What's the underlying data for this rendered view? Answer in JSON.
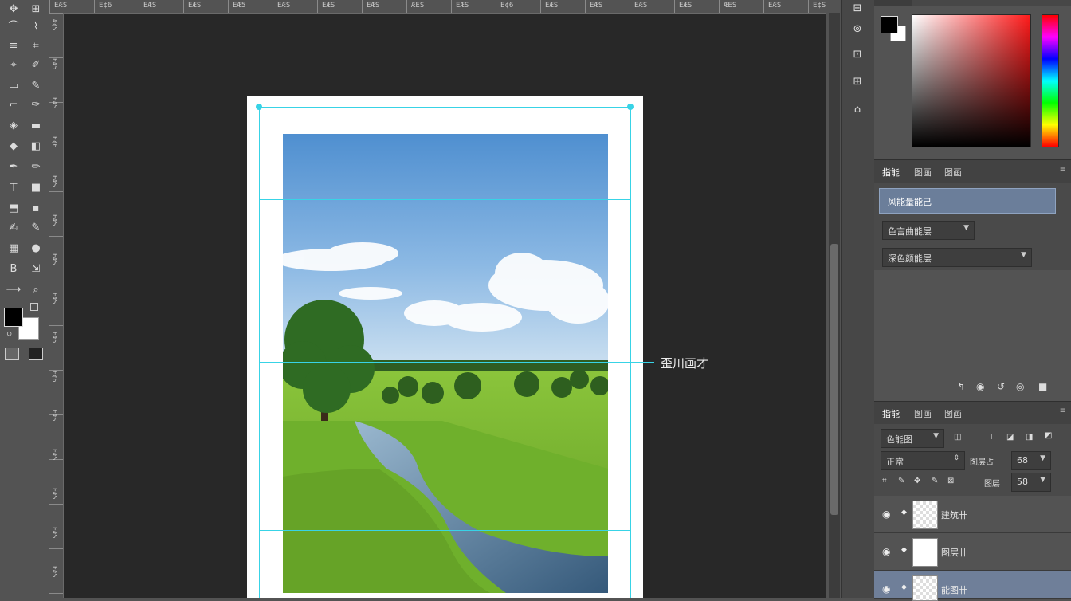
{
  "toolbar": {
    "tools": [
      "move-tool",
      "artboard-tool",
      "marquee-tool",
      "lasso-tool",
      "quick-select-tool",
      "crop-tool",
      "eyedropper-tool",
      "healing-tool",
      "brush-tool",
      "stamp-tool",
      "history-brush-tool",
      "eraser-tool",
      "gradient-tool",
      "blur-tool",
      "dodge-tool",
      "pen-tool",
      "type-tool",
      "path-select-tool",
      "shape-tool",
      "hand-tool",
      "zoom-tool",
      "edit-toolbar"
    ],
    "fg_color": "#000000",
    "bg_color": "#ffffff"
  },
  "ruler": {
    "top_labels": [
      "EÆS",
      "E¢6",
      "EÆS",
      "EÆS",
      "EÆ5",
      "EÆS",
      "EÆS",
      "EÆS",
      "ÆES",
      "EÆS",
      "E¢6",
      "EÆS",
      "EÆS",
      "EÆS",
      "EÆS",
      "ÆES",
      "EÆS",
      "E¢S"
    ],
    "left_labels": [
      "Æ¢S",
      "EÆ5",
      "EÆS",
      "E¢6",
      "EÆS",
      "EÆS",
      "EÆS",
      "EÆS",
      "EÆ5",
      "E¢6",
      "EÆS",
      "EÆS",
      "EÆS",
      "EÆS",
      "EÆS"
    ]
  },
  "canvas": {
    "guide_color": "#38d3e6",
    "callout_label": "歪川画才",
    "sky_color": "#5a9bd8",
    "grass_color": "#7cb732",
    "river_color": "#4d6f90"
  },
  "midstrip": {
    "icons": [
      "history-icon",
      "properties-icon",
      "adjust-icon",
      "libraries-icon",
      "shape-icon"
    ]
  },
  "color_panel": {
    "fg_color": "#000000",
    "bg_color": "#ffffff",
    "hue_color": "#ff1a1a"
  },
  "adjust_panel": {
    "tabs": [
      "指能",
      "图画",
      "图画"
    ],
    "selected_item": "风能量能己",
    "dropdown1": "色言曲能层",
    "dropdown2": "深色颜能层"
  },
  "layers_panel": {
    "tabs": [
      "指能",
      "图画",
      "图画"
    ],
    "kind_filter": "色能图",
    "blend_mode": "正常",
    "opacity_label": "图层占",
    "opacity_value": "68",
    "lock_label": "图层",
    "fill_value": "58",
    "layers": [
      {
        "name": "建筑卄",
        "selected": false
      },
      {
        "name": "图层卄",
        "selected": false
      },
      {
        "name": "能图卄",
        "selected": true
      }
    ]
  }
}
